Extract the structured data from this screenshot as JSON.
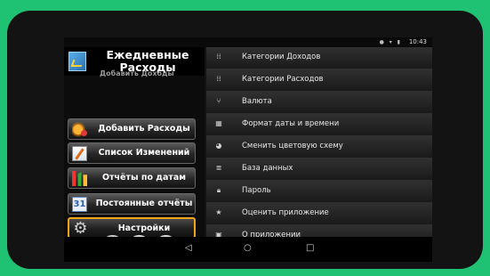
{
  "status_bar": {
    "time": "10:43",
    "icons": "● ▾ ▮"
  },
  "app": {
    "title": "Ежедневные Расходы",
    "header_overlap_text": "Добавить Доходы"
  },
  "nav": [
    {
      "label": "Добавить Расходы",
      "icon": "coins-icon"
    },
    {
      "label": "Список Изменений",
      "icon": "notepad-icon"
    },
    {
      "label": "Отчёты по датам",
      "icon": "bar-chart-icon"
    },
    {
      "label": "Постоянные отчёты",
      "icon": "calendar-icon",
      "icon_text": "31"
    },
    {
      "label": "Настройки",
      "icon": "gear-icon",
      "selected": true
    }
  ],
  "bottom_buttons": [
    {
      "icon": "coins-icon"
    },
    {
      "icon": "info-icon",
      "text": "i"
    },
    {
      "icon": "power-icon",
      "text": "⏻"
    }
  ],
  "settings": [
    {
      "label": "Категории Доходов",
      "icon": "tree-icon",
      "glyph": "⁞⁞"
    },
    {
      "label": "Категории Расходов",
      "icon": "tree-icon",
      "glyph": "⁞⁞"
    },
    {
      "label": "Валюта",
      "icon": "currency-icon",
      "glyph": "⑂"
    },
    {
      "label": "Формат даты и времени",
      "icon": "calendar-icon",
      "glyph": "▦"
    },
    {
      "label": "Сменить цветовую схему",
      "icon": "palette-icon",
      "glyph": "◕"
    },
    {
      "label": "База данных",
      "icon": "database-icon",
      "glyph": "≣"
    },
    {
      "label": "Пароль",
      "icon": "lock-icon",
      "glyph": "🔒︎"
    },
    {
      "label": "Оценить приложение",
      "icon": "star-icon",
      "glyph": "★"
    },
    {
      "label": "О приложении",
      "icon": "info-icon",
      "glyph": "▣"
    }
  ],
  "navbar": {
    "back": "◁",
    "home": "○",
    "recents": "□"
  },
  "colors": {
    "background": "#1fc173",
    "selected_border": "#f2a519"
  }
}
